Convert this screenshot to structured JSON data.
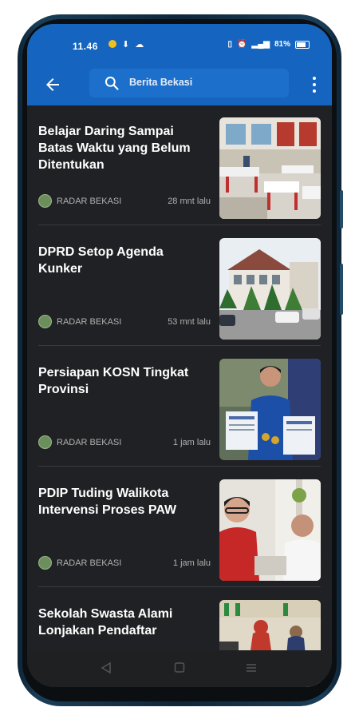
{
  "status": {
    "time": "11.46",
    "battery": "81%"
  },
  "search": {
    "query": "Berita Bekasi"
  },
  "articles": [
    {
      "title": "Belajar Daring Sampai Batas Waktu yang Belum Ditentukan",
      "source": "RADAR BEKASI",
      "time": "28 mnt lalu"
    },
    {
      "title": "DPRD Setop Agenda Kunker",
      "source": "RADAR BEKASI",
      "time": "53 mnt lalu"
    },
    {
      "title": "Persiapan KOSN Tingkat Provinsi",
      "source": "RADAR BEKASI",
      "time": "1 jam lalu"
    },
    {
      "title": "PDIP Tuding Walikota Intervensi Proses PAW",
      "source": "RADAR BEKASI",
      "time": "1 jam lalu"
    },
    {
      "title": "Sekolah Swasta Alami Lonjakan Pendaftar",
      "source": "",
      "time": ""
    }
  ],
  "colors": {
    "appbar": "#1565c0",
    "background": "#202124"
  }
}
